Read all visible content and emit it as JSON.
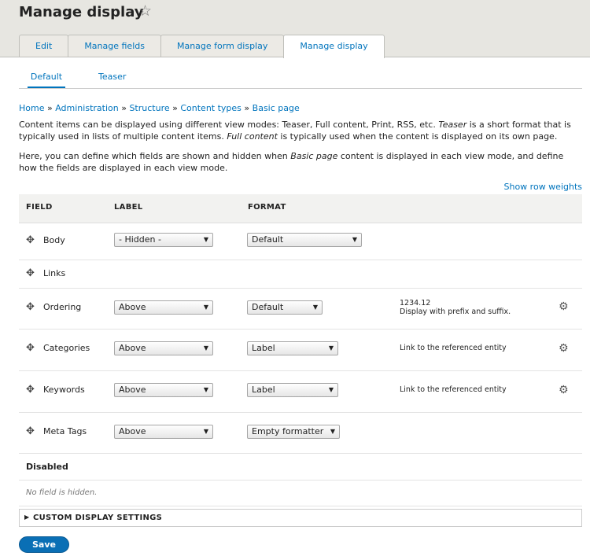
{
  "page": {
    "title": "Manage display"
  },
  "primary_tabs": [
    "Edit",
    "Manage fields",
    "Manage form display",
    "Manage display"
  ],
  "secondary_tabs": [
    "Default",
    "Teaser"
  ],
  "breadcrumb": [
    "Home",
    "Administration",
    "Structure",
    "Content types",
    "Basic page"
  ],
  "breadcrumb_sep": "»",
  "description": {
    "p1_a": "Content items can be displayed using different view modes: Teaser, Full content, Print, RSS, etc. ",
    "p1_teaser": "Teaser",
    "p1_b": " is a short format that is typically used in lists of multiple content items. ",
    "p1_full": "Full content",
    "p1_c": " is typically used when the content is displayed on its own page.",
    "p2_a": "Here, you can define which fields are shown and hidden when ",
    "p2_basic": "Basic page",
    "p2_b": " content is displayed in each view mode, and define how the fields are displayed in each view mode."
  },
  "show_row_weights": "Show row weights",
  "table": {
    "headers": {
      "field": "FIELD",
      "label": "LABEL",
      "format": "FORMAT"
    },
    "rows": [
      {
        "name": "Body",
        "label": "- Hidden -",
        "format": "Default"
      },
      {
        "name": "Links"
      },
      {
        "name": "Ordering",
        "label": "Above",
        "format": "Default",
        "summary1": "1234.12",
        "summary2": "Display with prefix and suffix."
      },
      {
        "name": "Categories",
        "label": "Above",
        "format": "Label",
        "summary1": "Link to the referenced entity"
      },
      {
        "name": "Keywords",
        "label": "Above",
        "format": "Label",
        "summary1": "Link to the referenced entity"
      },
      {
        "name": "Meta Tags",
        "label": "Above",
        "format": "Empty formatter"
      }
    ],
    "disabled_title": "Disabled",
    "disabled_empty": "No field is hidden."
  },
  "custom_display": "CUSTOM DISPLAY SETTINGS",
  "save_label": "Save",
  "icons": {
    "favorite": "star-outline-icon",
    "drag": "move-arrows-icon",
    "settings": "gear-icon"
  }
}
